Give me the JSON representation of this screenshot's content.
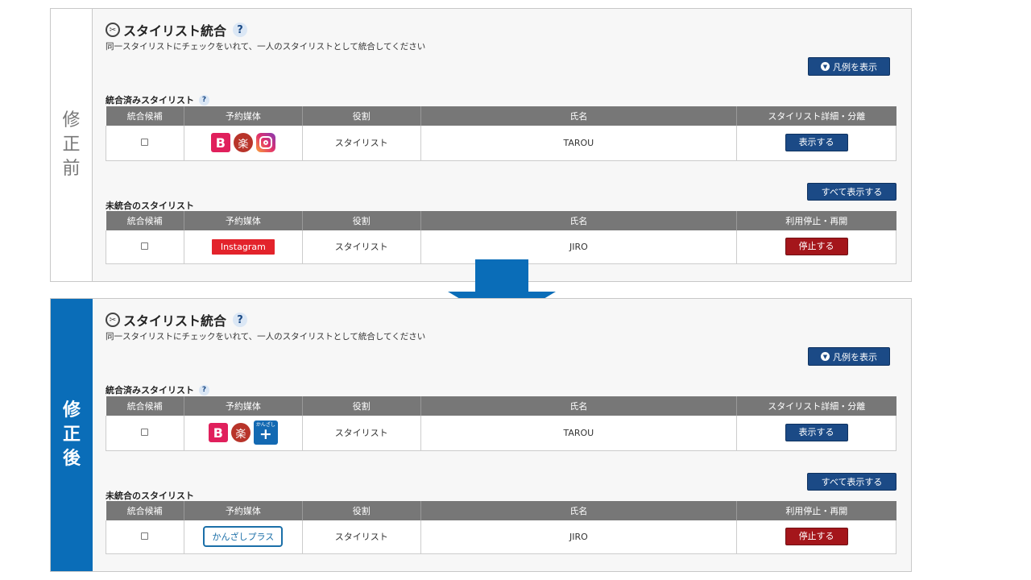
{
  "before": {
    "side_label": [
      "修",
      "正",
      "前"
    ],
    "title": "スタイリスト統合",
    "title_help": "?",
    "description": "同一スタイリストにチェックをいれて、一人のスタイリストとして統合してください",
    "legend_button": "凡例を表示",
    "integrated_label": "統合済みスタイリスト",
    "integrated_help": "?",
    "integrated_headers": [
      "統合候補",
      "予約媒体",
      "役割",
      "氏名",
      "スタイリスト詳細・分離"
    ],
    "integrated_row": {
      "role": "スタイリスト",
      "name": "TAROU",
      "button": "表示する",
      "media_icons": [
        "B",
        "楽",
        "instagram-icon"
      ]
    },
    "show_all_button": "すべて表示する",
    "unintegrated_label": "未統合のスタイリスト",
    "unintegrated_headers": [
      "統合候補",
      "予約媒体",
      "役割",
      "氏名",
      "利用停止・再開"
    ],
    "unintegrated_row": {
      "media": "Instagram",
      "role": "スタイリスト",
      "name": "JIRO",
      "button": "停止する"
    }
  },
  "after": {
    "side_label": [
      "修",
      "正",
      "後"
    ],
    "title": "スタイリスト統合",
    "title_help": "?",
    "description": "同一スタイリストにチェックをいれて、一人のスタイリストとして統合してください",
    "legend_button": "凡例を表示",
    "integrated_label": "統合済みスタイリスト",
    "integrated_help": "?",
    "integrated_headers": [
      "統合候補",
      "予約媒体",
      "役割",
      "氏名",
      "スタイリスト詳細・分離"
    ],
    "integrated_row": {
      "role": "スタイリスト",
      "name": "TAROU",
      "button": "表示する",
      "media_icons": [
        "B",
        "楽",
        "かんざし",
        "+"
      ]
    },
    "show_all_button": "すべて表示する",
    "unintegrated_label": "未統合のスタイリスト",
    "unintegrated_headers": [
      "統合候補",
      "予約媒体",
      "役割",
      "氏名",
      "利用停止・再開"
    ],
    "unintegrated_row": {
      "media": "かんざしプラス",
      "role": "スタイリスト",
      "name": "JIRO",
      "button": "停止する"
    }
  },
  "colors": {
    "navy": "#1b4a86",
    "red": "#a4161b",
    "arrow_blue": "#0a6db8",
    "header_gray": "#777777"
  }
}
